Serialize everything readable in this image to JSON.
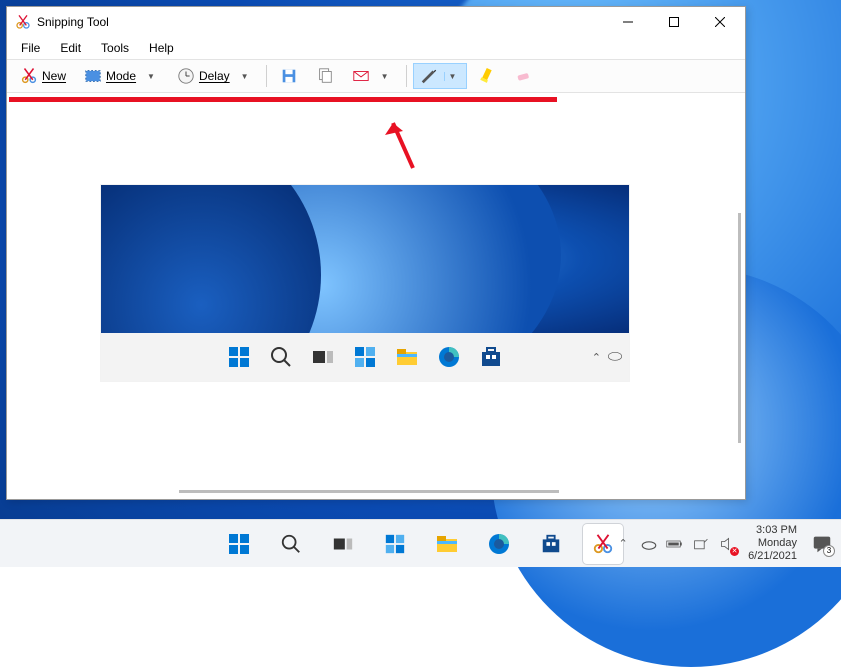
{
  "window": {
    "title": "Snipping Tool",
    "menubar": {
      "file": "File",
      "edit": "Edit",
      "tools": "Tools",
      "help": "Help"
    },
    "toolbar": {
      "new_label": "New",
      "mode_label": "Mode",
      "delay_label": "Delay"
    }
  },
  "outer_tray": {
    "time": "3:03 PM",
    "day": "Monday",
    "date": "6/21/2021",
    "notif_count": "3"
  }
}
